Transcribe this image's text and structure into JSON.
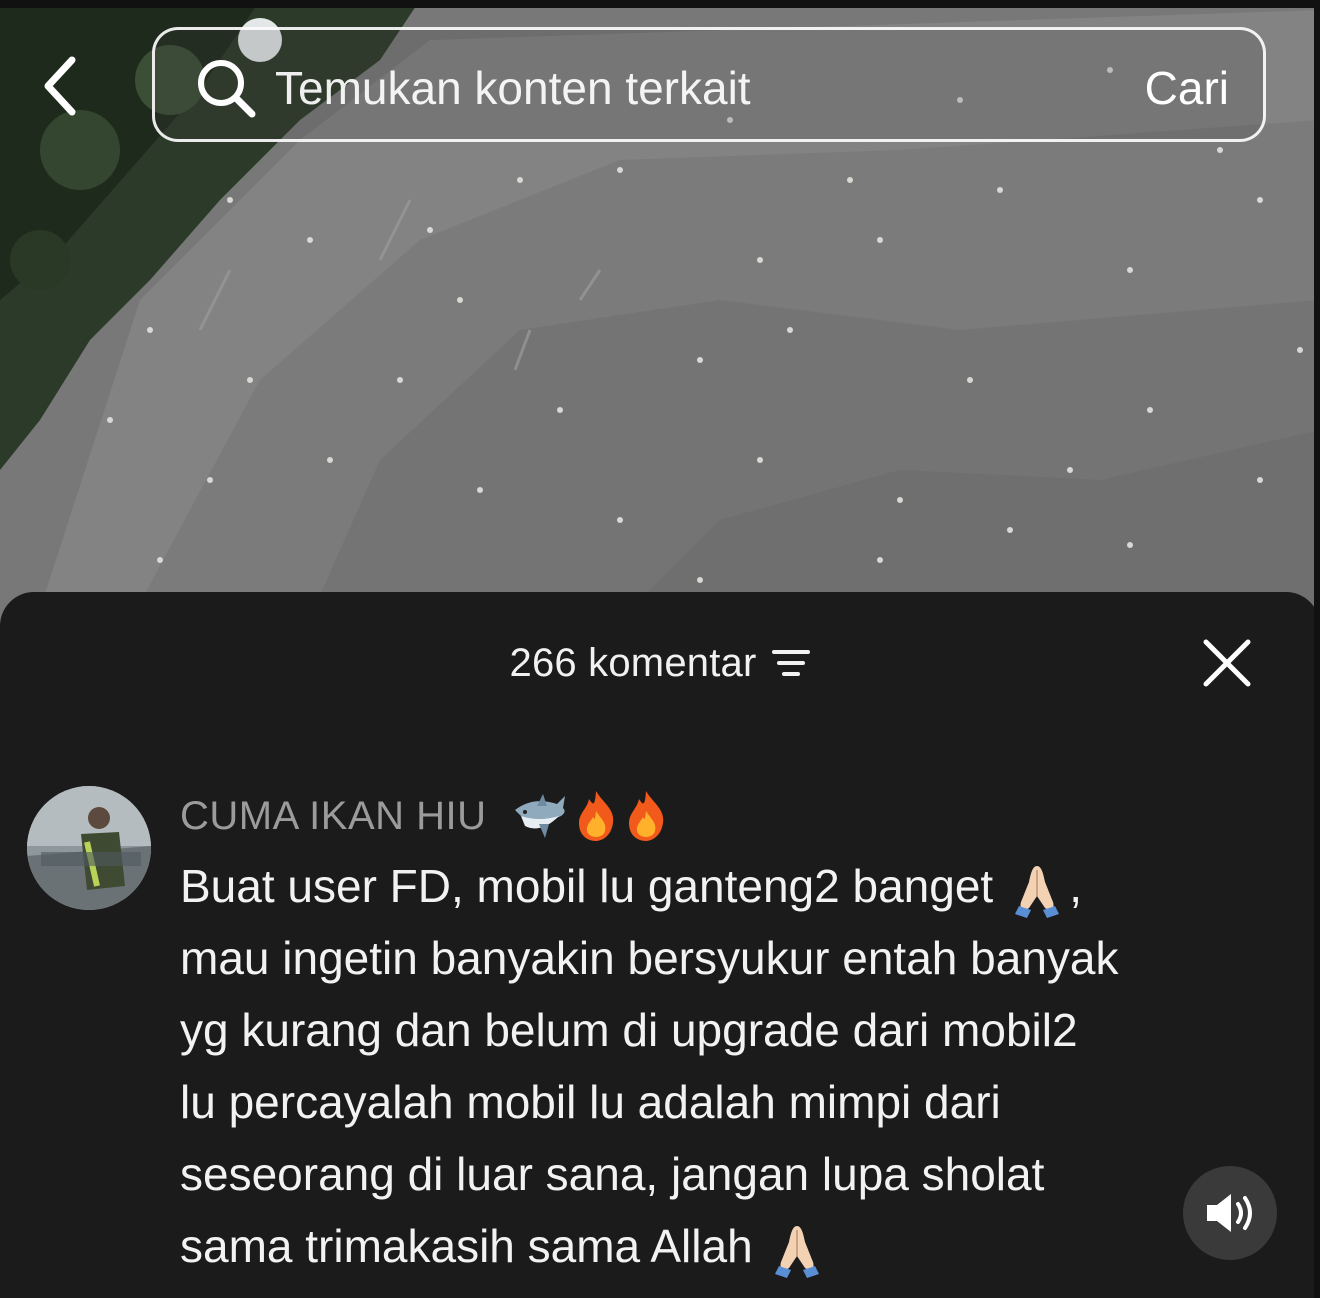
{
  "search": {
    "placeholder": "Temukan konten terkait",
    "button_label": "Cari"
  },
  "icons": {
    "back": "chevron-left-icon",
    "search": "search-icon",
    "filter": "filter-icon",
    "close": "close-icon",
    "sound": "speaker-icon"
  },
  "comments_panel": {
    "count_label": "266 komentar"
  },
  "comment": {
    "username": "CUMA IKAN HIU",
    "username_emojis": [
      "shark-emoji",
      "fire-emoji",
      "fire-emoji"
    ],
    "lines": [
      "Buat user FD, mobil lu ganteng2 banget",
      ",",
      "mau ingetin banyakin bersyukur entah banyak",
      "yg kurang dan belum di upgrade dari mobil2",
      "lu percayalah mobil lu adalah mimpi dari",
      "seseorang di luar sana, jangan lupa sholat",
      "sama trimakasih sama Allah"
    ]
  },
  "colors": {
    "sheet_bg": "#1b1b1b",
    "username": "#9b9b9b",
    "text": "#f2f2f2"
  }
}
